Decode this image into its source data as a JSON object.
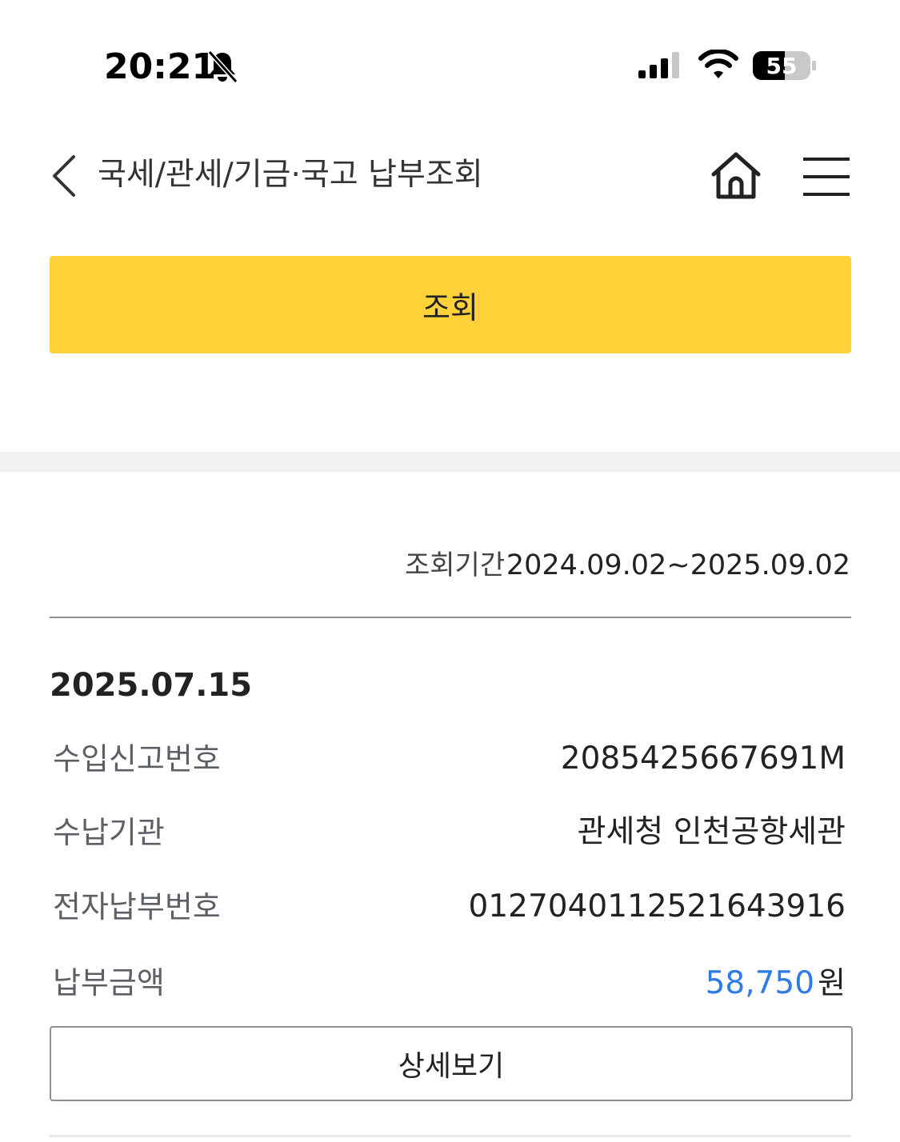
{
  "status_bar": {
    "time": "20:21",
    "battery_level": "55",
    "icons": [
      "bell-slash-icon",
      "signal-icon",
      "wifi-icon",
      "battery-icon"
    ]
  },
  "header": {
    "title": "국세/관세/기금·국고 납부조회",
    "icons": [
      "back-chevron-icon",
      "home-icon",
      "menu-icon"
    ]
  },
  "search_button": {
    "label": "조회"
  },
  "period": {
    "label": "조회기간",
    "value": "2024.09.02~2025.09.02"
  },
  "record": {
    "date": "2025.07.15",
    "rows": [
      {
        "label": "수입신고번호",
        "value": "2085425667691M"
      },
      {
        "label": "수납기관",
        "value": "관세청 인천공항세관"
      },
      {
        "label": "전자납부번호",
        "value": "0127040112521643916"
      }
    ],
    "amount": {
      "label": "납부금액",
      "value": "58,750",
      "unit": "원"
    },
    "detail_button": "상세보기"
  },
  "colors": {
    "accent_yellow": "#ffd23a",
    "amount_blue": "#2f7be6",
    "section_band": "#f0f1f3"
  }
}
